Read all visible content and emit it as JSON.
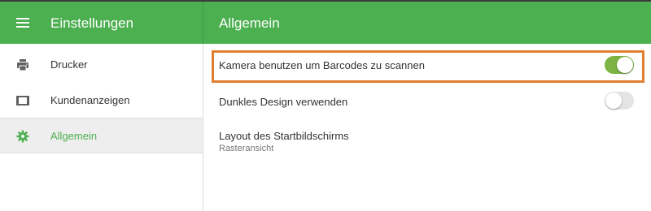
{
  "app": {
    "title": "Einstellungen"
  },
  "page": {
    "title": "Allgemein"
  },
  "sidebar": {
    "items": [
      {
        "label": "Drucker",
        "icon": "printer-icon",
        "active": false
      },
      {
        "label": "Kundenanzeigen",
        "icon": "display-icon",
        "active": false
      },
      {
        "label": "Allgemein",
        "icon": "gear-icon",
        "active": true
      }
    ]
  },
  "settings": {
    "camera_barcode": {
      "label": "Kamera benutzen um Barcodes zu scannen",
      "enabled": true
    },
    "dark_design": {
      "label": "Dunkles Design verwenden",
      "enabled": false
    },
    "start_layout": {
      "label": "Layout des Startbildschirms",
      "value": "Rasteransicht"
    }
  },
  "colors": {
    "accent": "#4caf50",
    "toggle_on": "#7cb342",
    "highlight": "#e27f2e"
  }
}
